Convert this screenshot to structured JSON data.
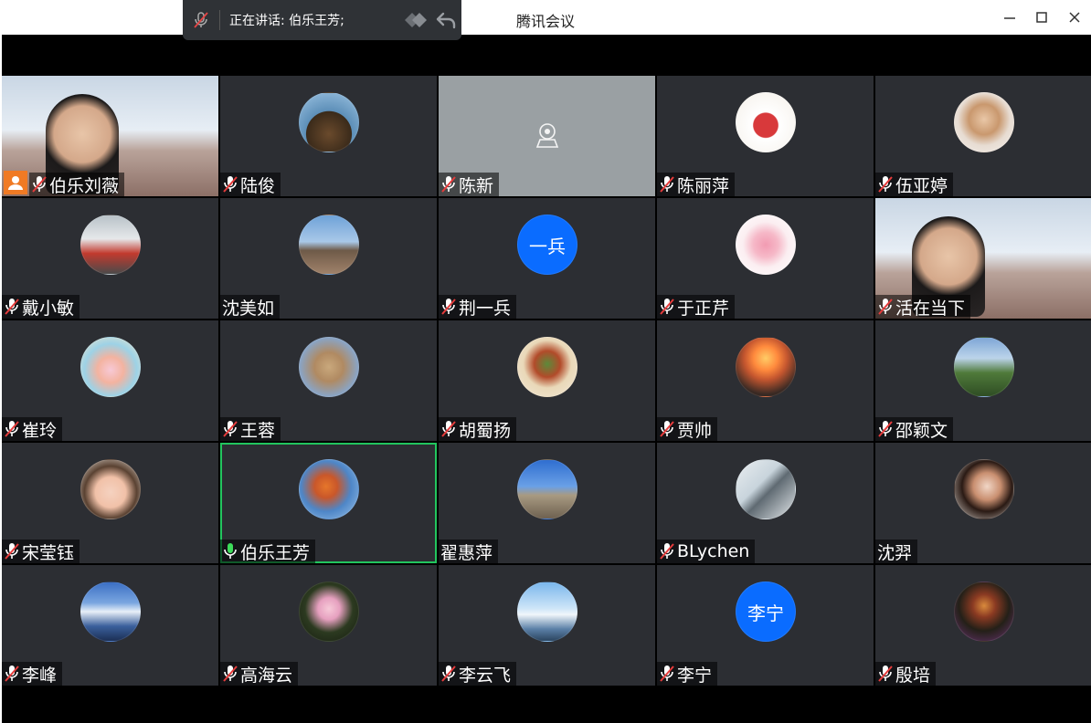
{
  "window": {
    "title": "腾讯会议"
  },
  "speaking": {
    "text": "正在讲话: 伯乐王芳;"
  },
  "colors": {
    "active_border": "#22c55e",
    "host_badge": "#f07a24",
    "avatar_blue": "#0a6cff",
    "tile_bg": "#2c2e33"
  },
  "participants": [
    {
      "name": "伯乐刘薇",
      "mic": "muted",
      "host": true,
      "video": true
    },
    {
      "name": "陆俊",
      "mic": "muted"
    },
    {
      "name": "陈新",
      "mic": "muted",
      "camera_placeholder": true
    },
    {
      "name": "陈丽萍",
      "mic": "muted"
    },
    {
      "name": "伍亚婷",
      "mic": "muted"
    },
    {
      "name": "戴小敏",
      "mic": "muted"
    },
    {
      "name": "沈美如",
      "mic": "none"
    },
    {
      "name": "荆一兵",
      "mic": "muted",
      "avatar_text": "一兵"
    },
    {
      "name": "于正芹",
      "mic": "muted"
    },
    {
      "name": "活在当下",
      "mic": "muted",
      "video": true
    },
    {
      "name": "崔玲",
      "mic": "muted"
    },
    {
      "name": "王蓉",
      "mic": "muted"
    },
    {
      "name": "胡蜀扬",
      "mic": "muted"
    },
    {
      "name": "贾帅",
      "mic": "muted"
    },
    {
      "name": "邵颖文",
      "mic": "muted"
    },
    {
      "name": "宋莹钰",
      "mic": "muted"
    },
    {
      "name": "伯乐王芳",
      "mic": "speaking",
      "active": true
    },
    {
      "name": "翟惠萍",
      "mic": "none"
    },
    {
      "name": "BLychen",
      "mic": "muted"
    },
    {
      "name": "沈羿",
      "mic": "none"
    },
    {
      "name": "李峰",
      "mic": "muted"
    },
    {
      "name": "高海云",
      "mic": "muted"
    },
    {
      "name": "李云飞",
      "mic": "muted"
    },
    {
      "name": "李宁",
      "mic": "muted",
      "avatar_text": "李宁"
    },
    {
      "name": "殷培",
      "mic": "muted"
    }
  ]
}
